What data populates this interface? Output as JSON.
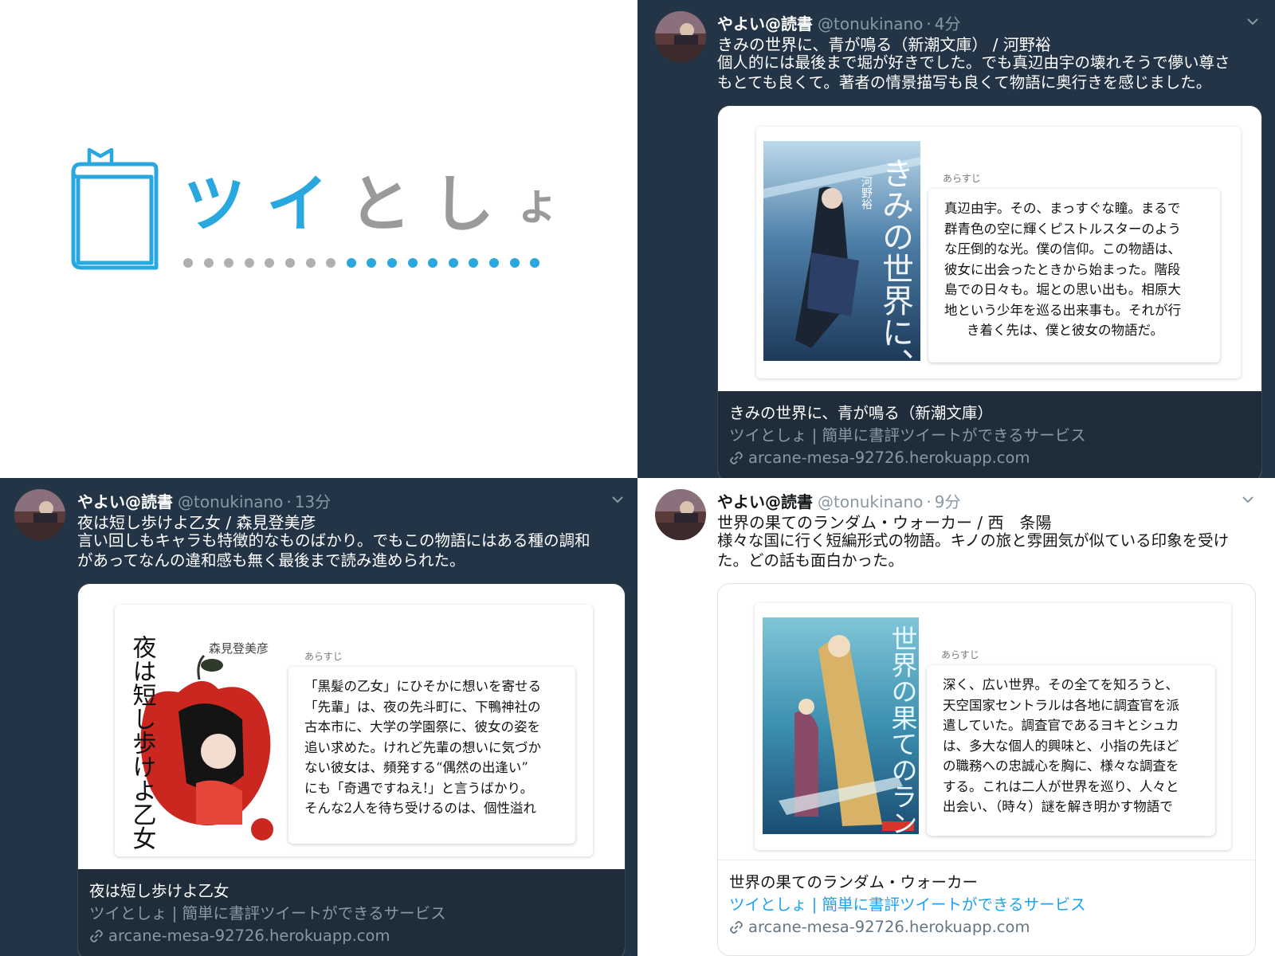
{
  "logo": {
    "wordmark": [
      "ツ",
      "イ",
      "と",
      "し",
      "ょ"
    ],
    "wordmark_colors": [
      "#29a8e0",
      "#29a8e0",
      "#9a9a9a",
      "#9a9a9a",
      "#9a9a9a"
    ],
    "dot_colors": [
      "#b0b0b0",
      "#b0b0b0",
      "#b0b0b0",
      "#b0b0b0",
      "#b0b0b0",
      "#b0b0b0",
      "#b0b0b0",
      "#b0b0b0",
      "#29a8e0",
      "#29a8e0",
      "#29a8e0",
      "#29a8e0",
      "#29a8e0",
      "#29a8e0",
      "#29a8e0",
      "#29a8e0",
      "#29a8e0",
      "#29a8e0"
    ],
    "icon": "book-bookmark-icon",
    "accent": "#29a8e0"
  },
  "tweets": [
    {
      "theme": "dark",
      "name": "やよい@読書",
      "handle": "@tonukinano",
      "separator": "·",
      "time": "4分",
      "book_line": "きみの世界に、青が鳴る（新潮文庫） / 河野裕",
      "body": [
        "個人的には最後まで堀が好きでした。でも真辺由宇の壊れそうで儚い尊さ",
        "もとても良くて。著者の情景描写も良くて物語に奥行きを感じました。"
      ],
      "card": {
        "cover_text": "きみの世界に、青が鳴る",
        "cover_author": "河野裕",
        "synopsis_label": "あらすじ",
        "synopsis": [
          "真辺由宇。その、まっすぐな瞳。まるで",
          "群青色の空に輝くピストルスターのよう",
          "な圧倒的な光。僕の信仰。この物語は、",
          "彼女に出会ったときから始まった。階段",
          "島での日々も。堀との思い出も。相原大",
          "地という少年を巡る出来事も。それが行",
          "き着く先は、僕と彼女の物語だ。"
        ],
        "title": "きみの世界に、青が鳴る（新潮文庫）",
        "description": "ツイとしょ | 簡単に書評ツイートができるサービス",
        "domain": "arcane-mesa-92726.herokuapp.com"
      }
    },
    {
      "theme": "dark",
      "name": "やよい@読書",
      "handle": "@tonukinano",
      "separator": "·",
      "time": "13分",
      "book_line": "夜は短し歩けよ乙女 / 森見登美彦",
      "body": [
        "言い回しもキャラも特徴的なものばかり。でもこの物語にはある種の調和",
        "があってなんの違和感も無く最後まで読み進められた。"
      ],
      "card": {
        "cover_text": "夜は短し歩けよ乙女",
        "cover_author": "森見登美彦",
        "synopsis_label": "あらすじ",
        "synopsis": [
          "「黒髪の乙女」にひそかに想いを寄せる",
          "「先輩」は、夜の先斗町に、下鴨神社の",
          "古本市に、大学の学園祭に、彼女の姿を",
          "追い求めた。けれど先輩の想いに気づか",
          "ない彼女は、頻発する“偶然の出逢い”",
          "にも「奇遇ですねえ!」と言うばかり。",
          "そんな2人を待ち受けるのは、個性溢れ"
        ],
        "title": "夜は短し歩けよ乙女",
        "description": "ツイとしょ | 簡単に書評ツイートができるサービス",
        "domain": "arcane-mesa-92726.herokuapp.com"
      }
    },
    {
      "theme": "light",
      "name": "やよい@読書",
      "handle": "@tonukinano",
      "separator": "·",
      "time": "9分",
      "book_line": "世界の果てのランダム・ウォーカー / 西　条陽",
      "body": [
        "様々な国に行く短編形式の物語。キノの旅と雰囲気が似ている印象を受け",
        "た。どの話も面白かった。"
      ],
      "card": {
        "cover_text": "世界の果てのランダム・ウォーカー",
        "cover_author": "",
        "synopsis_label": "あらすじ",
        "synopsis": [
          "深く、広い世界。その全てを知ろうと、",
          "天空国家セントラルは各地に調査官を派",
          "遣していた。調査官であるヨキとシュカ",
          "は、多大な個人的興味と、小指の先ほど",
          "の職務への忠誠心を胸に、様々な調査を",
          "する。これは二人が世界を巡り、人々と",
          "出会い、（時々）謎を解き明かす物語で"
        ],
        "title": "世界の果てのランダム・ウォーカー",
        "description": "ツイとしょ | 簡単に書評ツイートができるサービス",
        "domain": "arcane-mesa-92726.herokuapp.com"
      }
    }
  ],
  "colors": {
    "dark_bg": "#243447",
    "dark_meta_bg": "#1f2d3b",
    "muted": "#8899a6",
    "link_blue": "#1da1f2"
  },
  "icons": [
    "chevron-down-icon",
    "link-icon",
    "avatar"
  ]
}
